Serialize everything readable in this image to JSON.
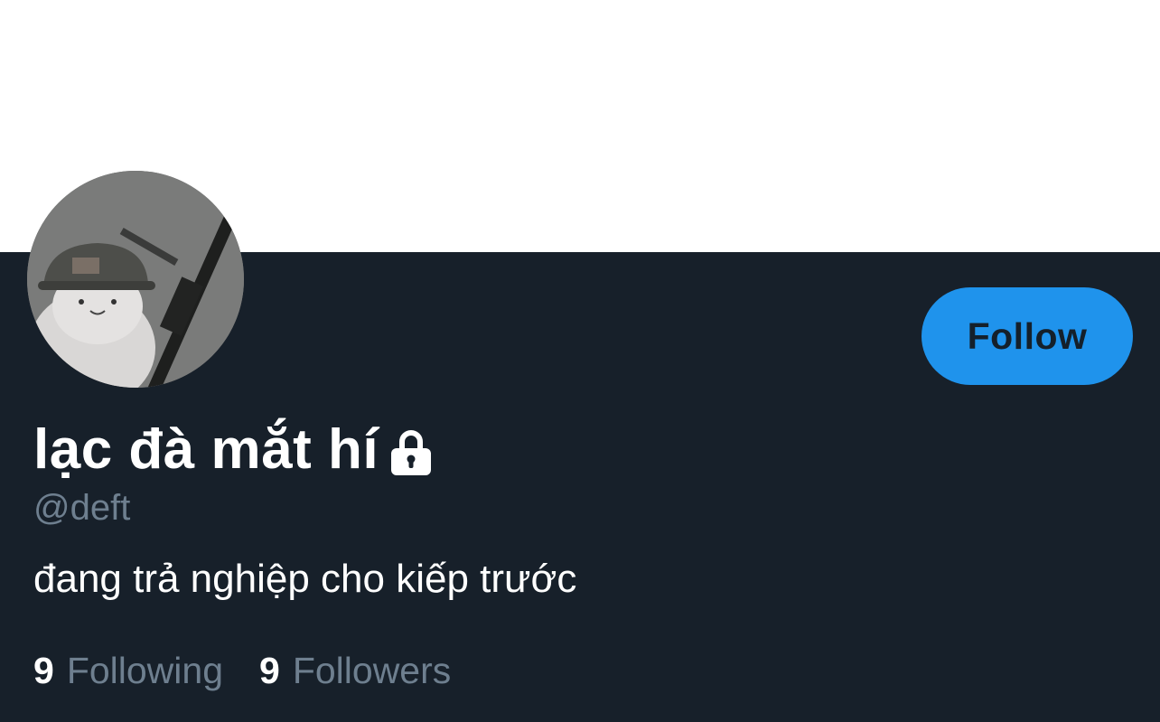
{
  "profile": {
    "display_name": "lạc đà mắt hí",
    "handle": "@deft",
    "bio": "đang trả nghiệp cho kiếp trước",
    "protected_icon": "lock-icon",
    "avatar_icon": "avatar-photo"
  },
  "actions": {
    "follow_label": "Follow"
  },
  "stats": {
    "following_count": "9",
    "following_label": "Following",
    "followers_count": "9",
    "followers_label": "Followers"
  },
  "colors": {
    "background": "#17202a",
    "banner": "#ffffff",
    "accent": "#1f93ec",
    "primary_text": "#ffffff",
    "secondary_text": "#6e7f8f"
  }
}
